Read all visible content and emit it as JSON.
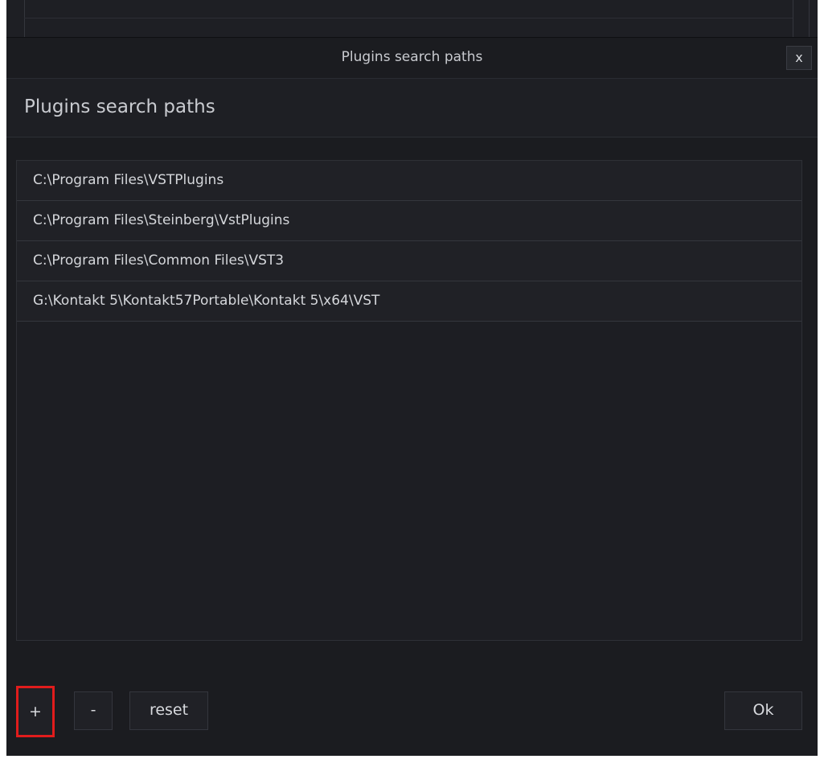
{
  "dialog": {
    "window_title": "Plugins search paths",
    "close_label": "x",
    "heading": "Plugins search paths"
  },
  "paths": [
    "C:\\Program Files\\VSTPlugins",
    "C:\\Program Files\\Steinberg\\VstPlugins",
    "C:\\Program Files\\Common Files\\VST3",
    "G:\\Kontakt 5\\Kontakt57Portable\\Kontakt 5\\x64\\VST"
  ],
  "buttons": {
    "add_label": "+",
    "remove_label": "-",
    "reset_label": "reset",
    "ok_label": "Ok"
  },
  "colors": {
    "background": "#1b1c20",
    "text": "#d5d7db",
    "highlight": "#e11c1c"
  }
}
